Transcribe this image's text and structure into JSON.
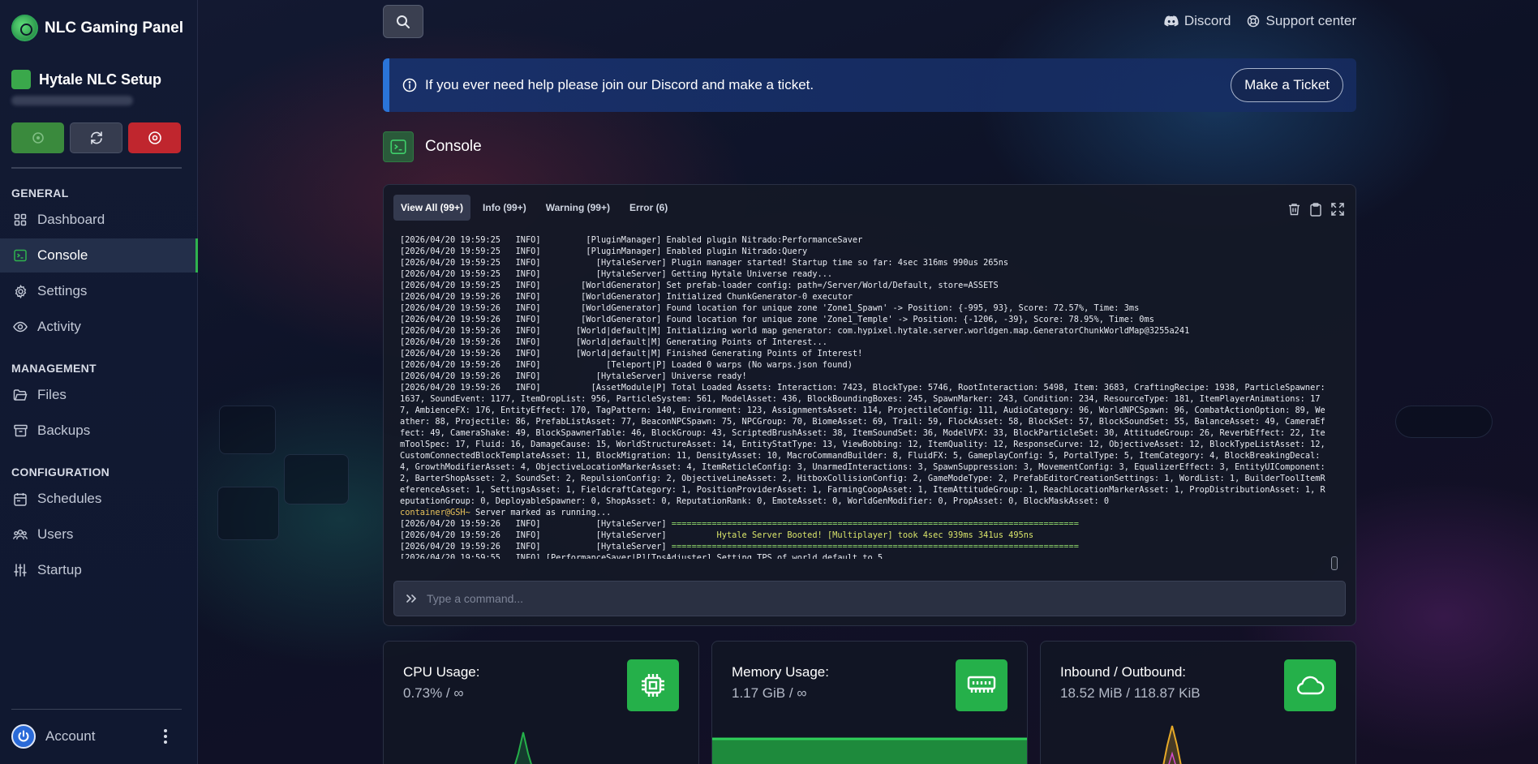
{
  "brand": {
    "name": "NLC Gaming Panel"
  },
  "server": {
    "name": "Hytale NLC Setup"
  },
  "sidebar": {
    "sections": [
      {
        "title": "GENERAL"
      },
      {
        "title": "MANAGEMENT"
      },
      {
        "title": "CONFIGURATION"
      }
    ],
    "items": [
      {
        "label": "Dashboard",
        "icon": "grid-icon"
      },
      {
        "label": "Console",
        "icon": "terminal-icon",
        "active": true
      },
      {
        "label": "Settings",
        "icon": "gear-icon"
      },
      {
        "label": "Activity",
        "icon": "eye-icon"
      },
      {
        "label": "Files",
        "icon": "folder-icon"
      },
      {
        "label": "Backups",
        "icon": "archive-icon"
      },
      {
        "label": "Schedules",
        "icon": "calendar-icon"
      },
      {
        "label": "Users",
        "icon": "users-icon"
      },
      {
        "label": "Startup",
        "icon": "sliders-icon"
      }
    ],
    "account_label": "Account"
  },
  "topbar": {
    "discord_label": "Discord",
    "support_label": "Support center"
  },
  "alert": {
    "text": "If you ever need help please join our Discord and make a ticket.",
    "button_label": "Make a Ticket"
  },
  "console": {
    "title": "Console",
    "tabs": [
      {
        "label": "View All (99+)",
        "active": true
      },
      {
        "label": "Info (99+)"
      },
      {
        "label": "Warning (99+)"
      },
      {
        "label": "Error (6)"
      }
    ],
    "log_lines": [
      "[2026/04/20 19:59:25   INFO]         [PluginManager] Enabled plugin Nitrado:PerformanceSaver",
      "[2026/04/20 19:59:25   INFO]         [PluginManager] Enabled plugin Nitrado:Query",
      "[2026/04/20 19:59:25   INFO]           [HytaleServer] Plugin manager started! Startup time so far: 4sec 316ms 990us 265ns",
      "[2026/04/20 19:59:25   INFO]           [HytaleServer] Getting Hytale Universe ready...",
      "[2026/04/20 19:59:25   INFO]        [WorldGenerator] Set prefab-loader config: path=/Server/World/Default, store=ASSETS",
      "[2026/04/20 19:59:26   INFO]        [WorldGenerator] Initialized ChunkGenerator-0 executor",
      "[2026/04/20 19:59:26   INFO]        [WorldGenerator] Found location for unique zone 'Zone1_Spawn' -> Position: {-995, 93}, Score: 72.57%, Time: 3ms",
      "[2026/04/20 19:59:26   INFO]        [WorldGenerator] Found location for unique zone 'Zone1_Temple' -> Position: {-1206, -39}, Score: 78.95%, Time: 0ms",
      "[2026/04/20 19:59:26   INFO]       [World|default|M] Initializing world map generator: com.hypixel.hytale.server.worldgen.map.GeneratorChunkWorldMap@3255a241",
      "[2026/04/20 19:59:26   INFO]       [World|default|M] Generating Points of Interest...",
      "[2026/04/20 19:59:26   INFO]       [World|default|M] Finished Generating Points of Interest!",
      "[2026/04/20 19:59:26   INFO]             [Teleport|P] Loaded 0 warps (No warps.json found)",
      "[2026/04/20 19:59:26   INFO]           [HytaleServer] Universe ready!",
      "[2026/04/20 19:59:26   INFO]          [AssetModule|P] Total Loaded Assets: Interaction: 7423, BlockType: 5746, RootInteraction: 5498, Item: 3683, CraftingRecipe: 1938, ParticleSpawner: 1637, SoundEvent: 1177, ItemDropList: 956, ParticleSystem: 561, ModelAsset: 436, BlockBoundingBoxes: 245, SpawnMarker: 243, Condition: 234, ResourceType: 181, ItemPlayerAnimations: 177, AmbienceFX: 176, EntityEffect: 170, TagPattern: 140, Environment: 123, AssignmentsAsset: 114, ProjectileConfig: 111, AudioCategory: 96, WorldNPCSpawn: 96, CombatActionOption: 89, Weather: 88, Projectile: 86, PrefabListAsset: 77, BeaconNPCSpawn: 75, NPCGroup: 70, BiomeAsset: 69, Trail: 59, FlockAsset: 58, BlockSet: 57, BlockSoundSet: 55, BalanceAsset: 49, CameraEffect: 49, CameraShake: 49, BlockSpawnerTable: 46, BlockGroup: 43, ScriptedBrushAsset: 38, ItemSoundSet: 36, ModelVFX: 33, BlockParticleSet: 30, AttitudeGroup: 26, ReverbEffect: 22, ItemToolSpec: 17, Fluid: 16, DamageCause: 15, WorldStructureAsset: 14, EntityStatType: 13, ViewBobbing: 12, ItemQuality: 12, ResponseCurve: 12, ObjectiveAsset: 12, BlockTypeListAsset: 12, CustomConnectedBlockTemplateAsset: 11, BlockMigration: 11, DensityAsset: 10, MacroCommandBuilder: 8, FluidFX: 5, GameplayConfig: 5, PortalType: 5, ItemCategory: 4, BlockBreakingDecal: 4, GrowthModifierAsset: 4, ObjectiveLocationMarkerAsset: 4, ItemReticleConfig: 3, UnarmedInteractions: 3, SpawnSuppression: 3, MovementConfig: 3, EqualizerEffect: 3, EntityUIComponent: 2, BarterShopAsset: 2, SoundSet: 2, RepulsionConfig: 2, ObjectiveLineAsset: 2, HitboxCollisionConfig: 2, GameModeType: 2, PrefabEditorCreationSettings: 1, WordList: 1, BuilderToolItemReferenceAsset: 1, SettingsAsset: 1, FieldcraftCategory: 1, PositionProviderAsset: 1, FarmingCoopAsset: 1, ItemAttitudeGroup: 1, ReachLocationMarkerAsset: 1, PropDistributionAsset: 1, ReputationGroup: 0, DeployableSpawner: 0, ShopAsset: 0, ReputationRank: 0, EmoteAsset: 0, WorldGenModifier: 0, PropAsset: 0, BlockMaskAsset: 0"
    ],
    "container_prefix": "container@GSH~",
    "container_message": " Server marked as running...",
    "boot_lines": [
      {
        "head": "[2026/04/20 19:59:26   INFO]           [HytaleServer] ",
        "body": "================================================================================="
      },
      {
        "head": "[2026/04/20 19:59:26   INFO]           [HytaleServer] ",
        "body": "         Hytale Server Booted! [Multiplayer] took 4sec 939ms 341us 495ns"
      },
      {
        "head": "[2026/04/20 19:59:26   INFO]           [HytaleServer] ",
        "body": "================================================================================="
      }
    ],
    "last_line": "[2026/04/20 19:59:55   INFO] [PerformanceSaver|P][TpsAdjuster] Setting TPS of world default to 5",
    "command_placeholder": "Type a command..."
  },
  "stats": [
    {
      "label": "CPU Usage:",
      "value": "0.73% / ∞",
      "icon": "cpu-icon"
    },
    {
      "label": "Memory Usage:",
      "value": "1.17 GiB / ∞",
      "icon": "memory-icon"
    },
    {
      "label": "Inbound / Outbound:",
      "value": "18.52 MiB / 118.87 KiB",
      "icon": "cloud-icon"
    }
  ],
  "colors": {
    "accent": "#25b04a",
    "danger": "#c0262e",
    "info": "#2a74d8",
    "log_prefix": "#e7c15a"
  }
}
